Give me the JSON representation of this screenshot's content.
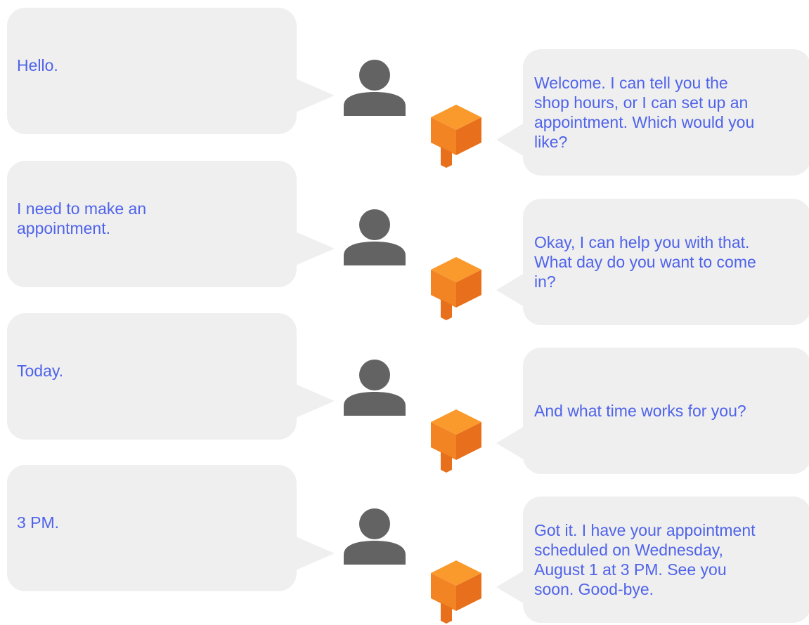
{
  "colors": {
    "bubble": "#efefef",
    "text": "#4f63ea",
    "person_icon": "#636363",
    "agent_icon_light": "#fb9a2c",
    "agent_icon_dark": "#e8701d"
  },
  "icons": {
    "user": "person-icon",
    "agent": "dialogflow-agent-icon"
  },
  "conversation": [
    {
      "user": "Hello.",
      "agent": "Welcome. I can tell you the\nshop hours, or I can set up an\nappointment. Which would you\nlike?"
    },
    {
      "user": "I need to make an\nappointment.",
      "agent": "Okay, I can help you with that.\nWhat day do you want to come\nin?"
    },
    {
      "user": "Today.",
      "agent": "And what time works for you?"
    },
    {
      "user": "3 PM.",
      "agent": "Got it. I have your appointment\nscheduled on Wednesday,\nAugust 1 at 3 PM. See you\nsoon. Good-bye."
    }
  ]
}
